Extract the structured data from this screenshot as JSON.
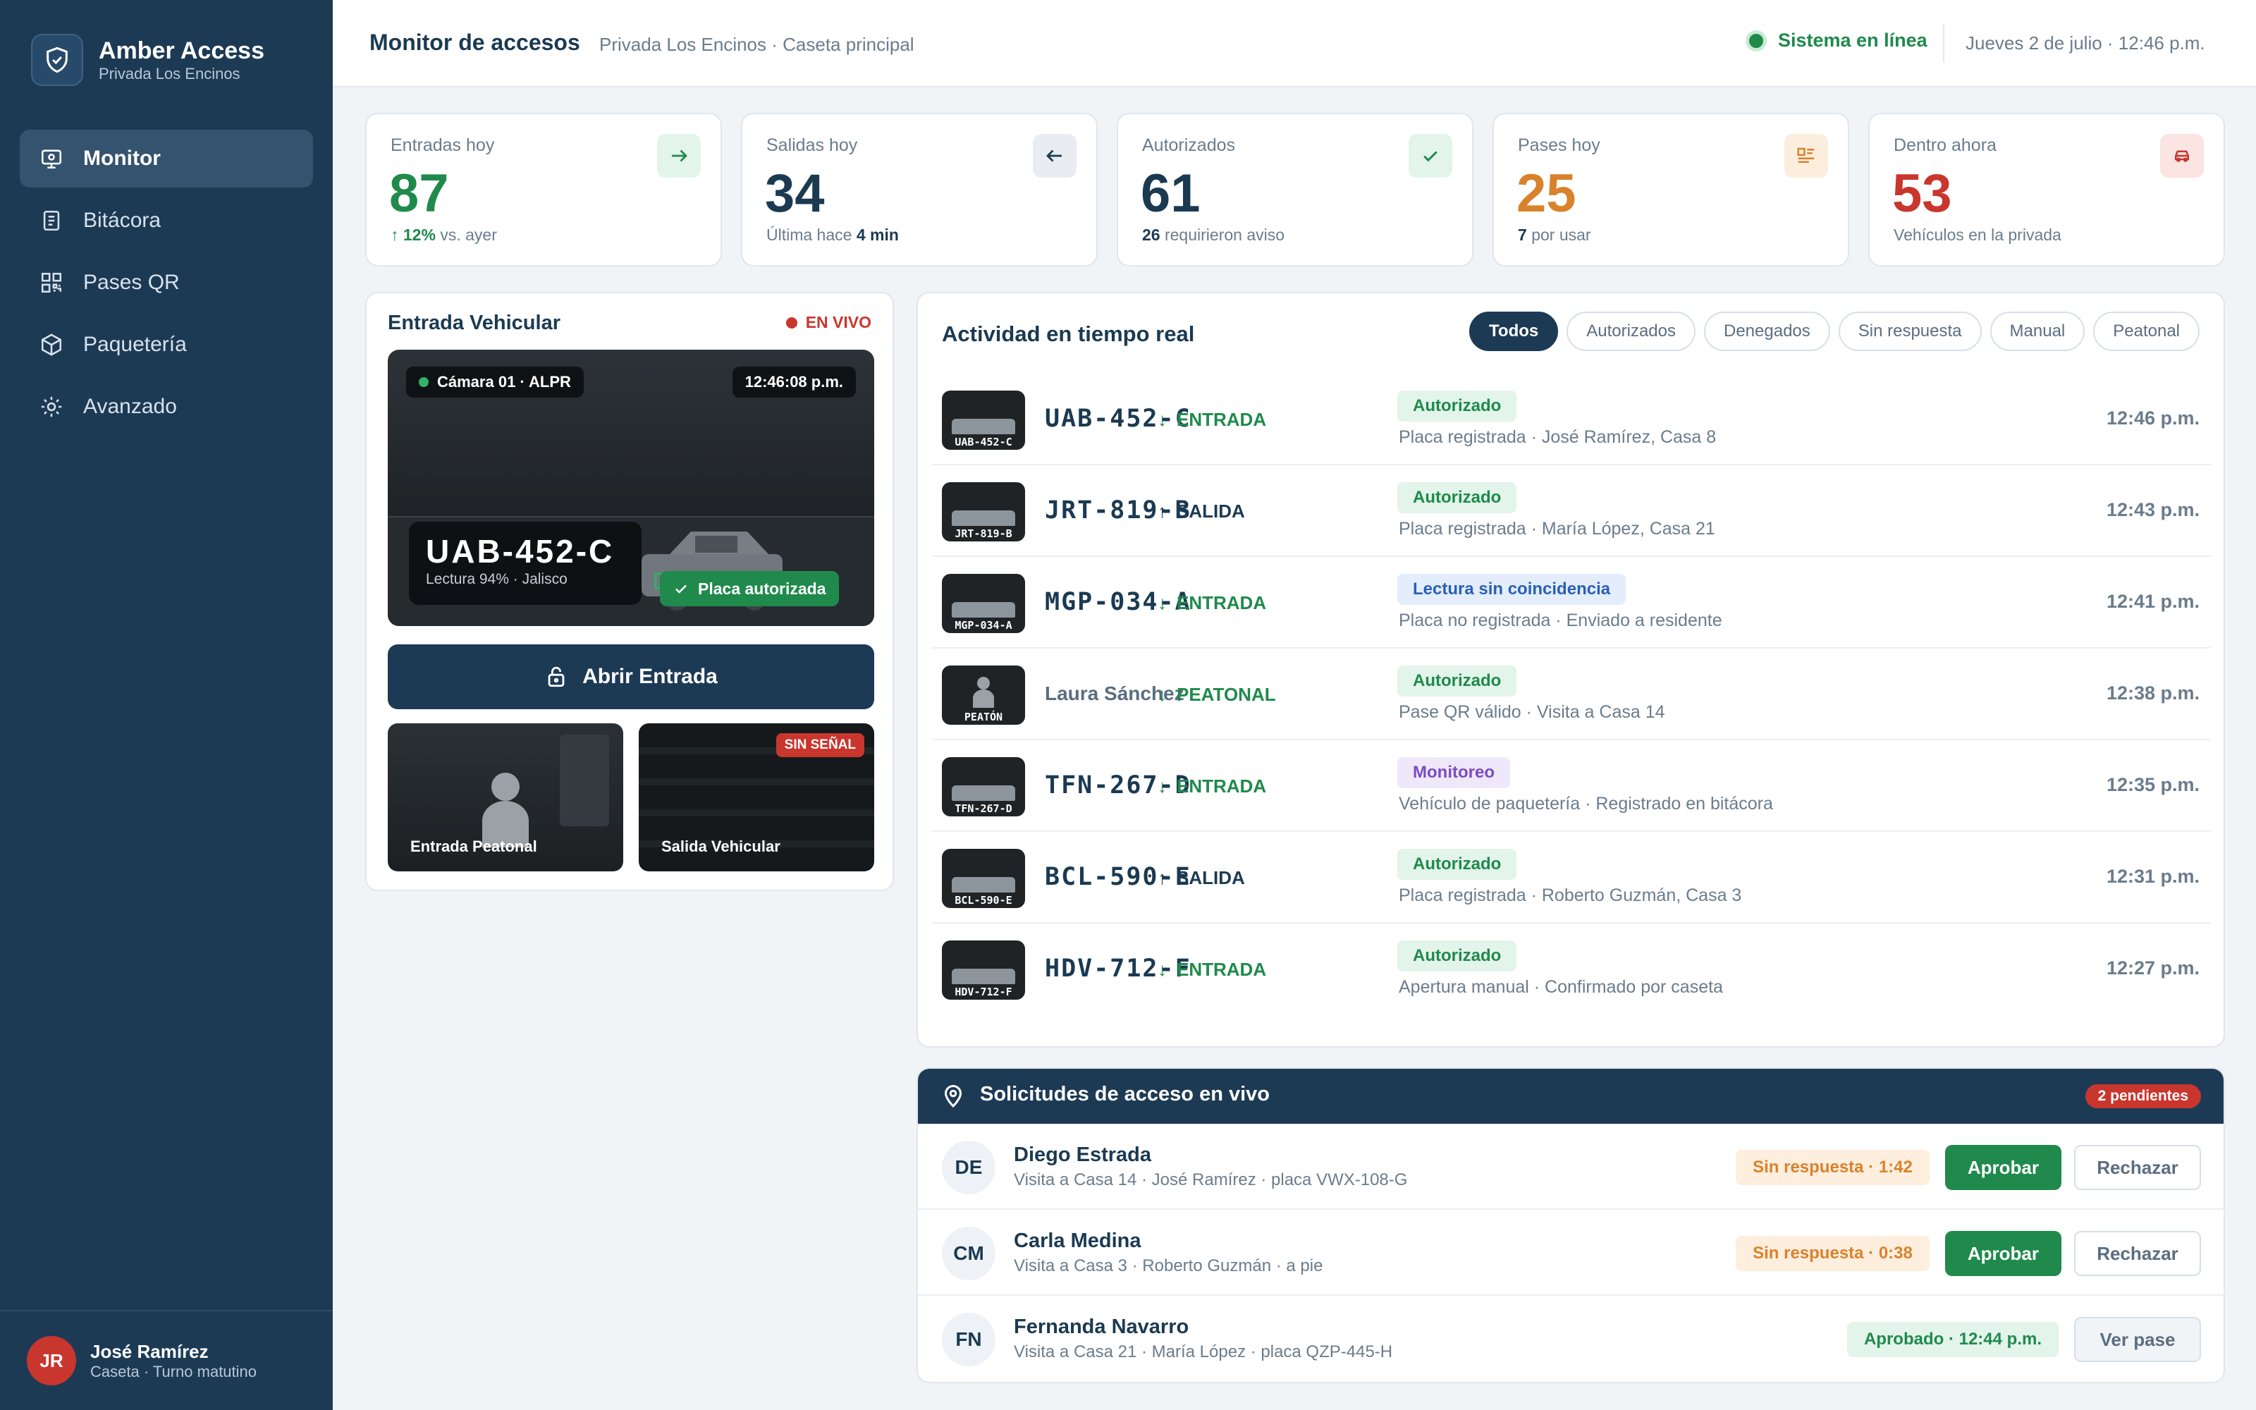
{
  "app": {
    "name": "Amber Access",
    "subtitle": "Privada Los Encinos"
  },
  "nav": [
    {
      "label": "Monitor",
      "icon": "monitor-icon",
      "active": true
    },
    {
      "label": "Bitácora",
      "icon": "logbook-icon"
    },
    {
      "label": "Pases QR",
      "icon": "qr-icon"
    },
    {
      "label": "Paquetería",
      "icon": "package-icon"
    },
    {
      "label": "Avanzado",
      "icon": "gear-icon"
    }
  ],
  "user": {
    "initials": "JR",
    "name": "José Ramírez",
    "role": "Caseta · Turno matutino"
  },
  "header": {
    "title": "Monitor de accesos",
    "subtitle": "Privada Los Encinos · Caseta principal",
    "status": "Sistema en línea",
    "datetime": "Jueves 2 de julio · 12:46 p.m."
  },
  "kpis": [
    {
      "label": "Entradas hoy",
      "value": "87",
      "sub_strong": "↑ 12%",
      "sub": "vs. ayer",
      "color": "#1f8a4c",
      "icon": "arrow-right-icon"
    },
    {
      "label": "Salidas hoy",
      "value": "34",
      "sub": "Última hace",
      "sub_strong": "4 min",
      "color": "#1b3a52",
      "icon": "arrow-left-icon"
    },
    {
      "label": "Autorizados",
      "value": "61",
      "sub_strong": "26",
      "sub": "requirieron aviso",
      "color": "#1b3a52",
      "icon": "check-icon"
    },
    {
      "label": "Pases hoy",
      "value": "25",
      "sub_strong": "7",
      "sub": "por usar",
      "color": "#d9822b",
      "icon": "pass-icon"
    },
    {
      "label": "Dentro ahora",
      "value": "53",
      "sub": "Vehículos en la privada",
      "color": "#c9362d",
      "icon": "car-icon"
    }
  ],
  "camera": {
    "title": "Entrada Vehicular",
    "live": "EN VIVO",
    "cam_name": "Cámara 01 · ALPR",
    "time": "12:46:08 p.m.",
    "plate": "UAB-452-C",
    "plate_sub": "Lectura 94% · Jalisco",
    "plate_status": "Placa autorizada",
    "open_label": "Abrir Entrada",
    "thumbs": [
      {
        "label": "Entrada Peatonal"
      },
      {
        "label": "Salida Vehicular",
        "badge": "SIN SEÑAL"
      }
    ]
  },
  "activity": {
    "title": "Actividad en tiempo real",
    "filters": [
      "Todos",
      "Autorizados",
      "Denegados",
      "Sin respuesta",
      "Manual",
      "Peatonal"
    ],
    "rows": [
      {
        "thumb": "UAB-452-C",
        "plate": "UAB-452-C",
        "dir": "ENTRADA",
        "arrow": "↓",
        "dir_color": "#1f8a4c",
        "badge": "Autorizado",
        "badge_kind": "green",
        "desc": "Placa registrada · José Ramírez, Casa 8",
        "time": "12:46 p.m."
      },
      {
        "thumb": "JRT-819-B",
        "plate": "JRT-819-B",
        "dir": "SALIDA",
        "arrow": "↑",
        "dir_color": "#1b3a52",
        "badge": "Autorizado",
        "badge_kind": "green",
        "desc": "Placa registrada · María López, Casa 21",
        "time": "12:43 p.m."
      },
      {
        "thumb": "MGP-034-A",
        "plate": "MGP-034-A",
        "dir": "ENTRADA",
        "arrow": "↓",
        "dir_color": "#1f8a4c",
        "badge": "Lectura sin coincidencia",
        "badge_kind": "blue",
        "desc": "Placa no registrada · Enviado a residente",
        "time": "12:41 p.m."
      },
      {
        "thumb": "PEATÓN",
        "plate": "Laura Sánchez",
        "person": true,
        "dir": "PEATONAL",
        "arrow": "↓",
        "dir_color": "#1f8a4c",
        "badge": "Autorizado",
        "badge_kind": "green",
        "desc": "Pase QR válido · Visita a Casa 14",
        "time": "12:38 p.m."
      },
      {
        "thumb": "TFN-267-D",
        "plate": "TFN-267-D",
        "dir": "ENTRADA",
        "arrow": "↓",
        "dir_color": "#1f8a4c",
        "badge": "Monitoreo",
        "badge_kind": "purple",
        "desc": "Vehículo de paquetería · Registrado en bitácora",
        "time": "12:35 p.m."
      },
      {
        "thumb": "BCL-590-E",
        "plate": "BCL-590-E",
        "dir": "SALIDA",
        "arrow": "↑",
        "dir_color": "#1b3a52",
        "badge": "Autorizado",
        "badge_kind": "green",
        "desc": "Placa registrada · Roberto Guzmán, Casa 3",
        "time": "12:31 p.m."
      },
      {
        "thumb": "HDV-712-F",
        "plate": "HDV-712-F",
        "dir": "ENTRADA",
        "arrow": "↓",
        "dir_color": "#1f8a4c",
        "badge": "Autorizado",
        "badge_kind": "green",
        "desc": "Apertura manual · Confirmado por caseta",
        "time": "12:27 p.m."
      }
    ]
  },
  "requests": {
    "title": "Solicitudes de acceso en vivo",
    "pending": "2 pendientes",
    "rows": [
      {
        "initials": "DE",
        "name": "Diego Estrada",
        "desc": "Visita a Casa 14 · José Ramírez · placa VWX-108-G",
        "status": "Sin respuesta · 1:42",
        "status_kind": "orange",
        "approve": "Aprobar",
        "secondary": "Rechazar"
      },
      {
        "initials": "CM",
        "name": "Carla Medina",
        "desc": "Visita a Casa 3 · Roberto Guzmán · a pie",
        "status": "Sin respuesta · 0:38",
        "status_kind": "orange",
        "approve": "Aprobar",
        "secondary": "Rechazar"
      },
      {
        "initials": "FN",
        "name": "Fernanda Navarro",
        "desc": "Visita a Casa 21 · María López · placa QZP-445-H",
        "status": "Aprobado · 12:44 p.m.",
        "status_kind": "green",
        "secondary": "Ver pase"
      }
    ]
  }
}
